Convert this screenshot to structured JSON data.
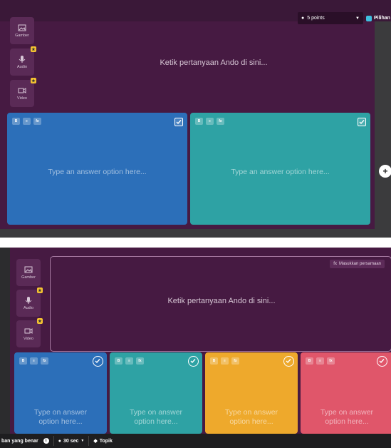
{
  "colors": {
    "editor_bg": "#461a42",
    "blue": "#2c6fb9",
    "teal": "#2ea2a4",
    "yellow": "#eea92c",
    "red": "#e0566a"
  },
  "media": {
    "image_label": "Gamber",
    "audio_label": "Audio",
    "video_label": "Video"
  },
  "top": {
    "points": "5 points",
    "pilih": "Pilihan"
  },
  "question_placeholder": "Ketik pertanyaan Ando di sini...",
  "answer_placeholder_wide": "Type an answer option here...",
  "answer_line1": "Type on answer",
  "answer_line2": "option here...",
  "tools": {
    "t1": "B",
    "t2": "≡",
    "t3": "fx"
  },
  "equation_label": "Masukkan persamaan",
  "bottom": {
    "correct": "ban yang benar",
    "time": "30 sec",
    "topic": "Topik"
  },
  "add_icon": "+"
}
